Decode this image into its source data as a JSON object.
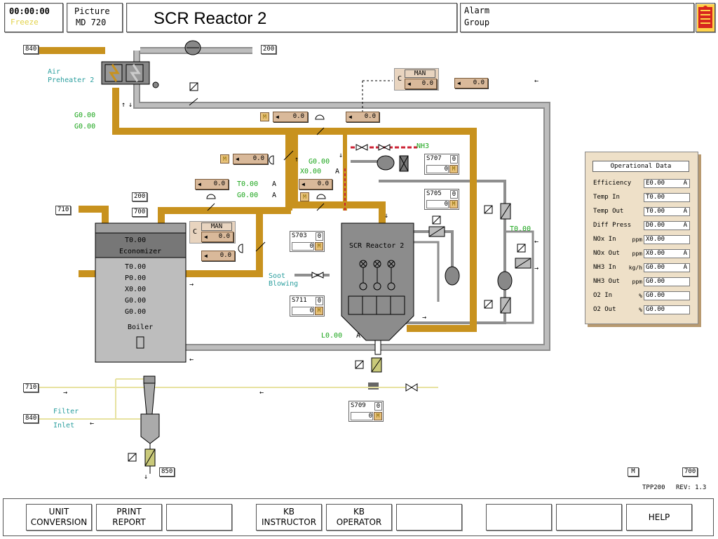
{
  "header": {
    "clock": "00:00:00",
    "freeze": "Freeze",
    "picture_label": "Picture",
    "picture_id": "MD 720",
    "title": "SCR Reactor 2",
    "alarm_label": "Alarm",
    "group_label": "Group"
  },
  "tags": {
    "t840_top": "840",
    "t200_top": "200",
    "t200_mid": "200",
    "t710_mid": "710",
    "t700_mid": "700",
    "t710_bot": "710",
    "t840_bot": "840",
    "t850": "850",
    "t700_br": "700",
    "m_br": "M"
  },
  "labels": {
    "air_preheater_1": "Air",
    "air_preheater_2": "Preheater 2",
    "g1": "G0.00",
    "g2": "G0.00",
    "nh3": "NH3",
    "g_nh3": "G0.00",
    "x_nh3": "X0.00",
    "a_nh3": "A",
    "t_eco": "T0.00",
    "a_eco": "A",
    "g_eco": "G0.00",
    "a_eco2": "A",
    "soot_1": "Soot",
    "soot_2": "Blowing",
    "t_right": "T0.00",
    "l_val": "L0.00",
    "l_a": "A",
    "filter_1": "Filter",
    "filter_2": "Inlet",
    "scr_reactor": "SCR Reactor 2",
    "tpp": "TPP200",
    "rev": "REV: 1.3",
    "c1": "C",
    "c2": "C"
  },
  "controllers": {
    "man1": "MAN",
    "man1_val": "0.0",
    "man1_ext": "0.0",
    "man2": "MAN",
    "man2_val": "0.0",
    "c_a": "0.0",
    "c_b": "0.0",
    "c_c": "0.0",
    "c_d": "0.0",
    "c_e": "0.0",
    "c_f": "0.0",
    "c_g": "0.0",
    "m_label": "M"
  },
  "switches": {
    "s707": "S707",
    "s707_v": "0",
    "s707_b": "0",
    "s705": "S705",
    "s705_v": "0",
    "s705_b": "0",
    "s703": "S703",
    "s703_v": "0",
    "s703_b": "0",
    "s711": "S711",
    "s711_v": "0",
    "s711_b": "0",
    "s709": "S709",
    "s709_v": "0",
    "s709_b": "0"
  },
  "boiler": {
    "eco_t": "T0.00",
    "eco_label": "Economizer",
    "v1": "T0.00",
    "v2": "P0.00",
    "v3": "X0.00",
    "v4": "G0.00",
    "v5": "G0.00",
    "label": "Boiler"
  },
  "op_data": {
    "title": "Operational Data",
    "rows": [
      {
        "label": "Efficiency",
        "unit": "",
        "value": "E0.00",
        "flag": "A"
      },
      {
        "label": "Temp In",
        "unit": "",
        "value": "T0.00",
        "flag": ""
      },
      {
        "label": "Temp Out",
        "unit": "",
        "value": "T0.00",
        "flag": "A"
      },
      {
        "label": "Diff Press",
        "unit": "",
        "value": "D0.00",
        "flag": "A"
      },
      {
        "label": "NOx In",
        "unit": "ppm",
        "value": "X0.00",
        "flag": ""
      },
      {
        "label": "NOx Out",
        "unit": "ppm",
        "value": "X0.00",
        "flag": "A"
      },
      {
        "label": "NH3 In",
        "unit": "kg/h",
        "value": "G0.00",
        "flag": "A"
      },
      {
        "label": "NH3 Out",
        "unit": "ppm",
        "value": "G0.00",
        "flag": ""
      },
      {
        "label": "O2 In",
        "unit": "%",
        "value": "G0.00",
        "flag": ""
      },
      {
        "label": "O2 Out",
        "unit": "%",
        "value": "G0.00",
        "flag": ""
      }
    ]
  },
  "fkeys": {
    "k1a": "UNIT",
    "k1b": "CONVERSION",
    "k2a": "PRINT",
    "k2b": "REPORT",
    "k4a": "KB",
    "k4b": "INSTRUCTOR",
    "k5a": "KB",
    "k5b": "OPERATOR",
    "k9": "HELP"
  },
  "colors": {
    "flue_gas": "#c8921e",
    "air": "#b3b3b3",
    "controller": "#d9b99a"
  }
}
